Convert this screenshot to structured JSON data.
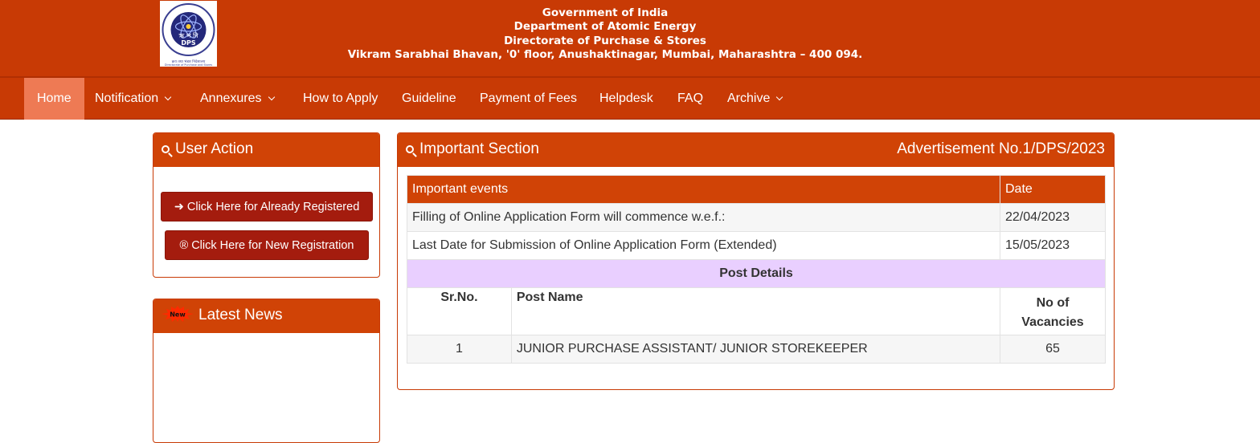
{
  "header": {
    "logo": {
      "script_text": "ऋ भ नि",
      "abbr": "DPS",
      "ring_text": "IN THE SERVICE OF THE NATION",
      "motto_hindi": "राष्ट्र की सेवा में समर्पित",
      "caption_hindi": "क्रय तथा भंडार निदेशालय",
      "caption_en": "Directorate of Purchase and Stores"
    },
    "line1": "Government of India",
    "line2": "Department of Atomic Energy",
    "line3": "Directorate of Purchase & Stores",
    "line4": "Vikram Sarabhai Bhavan, '0' floor, Anushaktinagar, Mumbai, Maharashtra – 400 094."
  },
  "nav": {
    "home": "Home",
    "notification": "Notification",
    "annexures": "Annexures",
    "how_to_apply": "How to Apply",
    "guideline": "Guideline",
    "payment": "Payment of Fees",
    "helpdesk": "Helpdesk",
    "faq": "FAQ",
    "archive": "Archive"
  },
  "user_action": {
    "title": "User Action",
    "already_registered": "➜ Click Here for Already Registered",
    "new_registration": "® Click Here for New Registration"
  },
  "latest_news": {
    "badge": "New",
    "title": "Latest News"
  },
  "important": {
    "title": "Important Section",
    "advertisement": "Advertisement No.1/DPS/2023",
    "events_header": "Important events",
    "date_header": "Date",
    "events": [
      {
        "event": "Filling of Online Application Form will commence w.e.f.:",
        "date": "22/04/2023"
      },
      {
        "event": "Last Date for Submission of Online Application Form (Extended)",
        "date": "15/05/2023"
      }
    ],
    "post_details_title": "Post Details",
    "post_columns": {
      "sr": "Sr.No.",
      "name": "Post Name",
      "vacancies": "No of Vacancies"
    },
    "posts": [
      {
        "sr": "1",
        "name": "JUNIOR PURCHASE ASSISTANT/ JUNIOR STOREKEEPER",
        "vacancies": "65"
      }
    ]
  }
}
